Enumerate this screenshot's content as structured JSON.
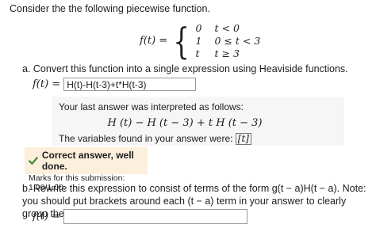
{
  "intro": "Consider the the following piecewise function.",
  "piecewise": {
    "lhs": "f(t) =",
    "cases": [
      {
        "value": "0",
        "condition": "t < 0"
      },
      {
        "value": "1",
        "condition": "0 ≤ t < 3"
      },
      {
        "value": "t",
        "condition": "t ≥ 3"
      }
    ]
  },
  "part_a": {
    "question": "a. Convert this function into a single expression using Heaviside functions.",
    "lhs": "f(t) =",
    "answer_value": "H(t)-H(t-3)+t*H(t-3)",
    "interpreted_label": "Your last answer was interpreted as follows:",
    "interpreted_math": "H (t) − H (t − 3) + t H (t − 3)",
    "variables_label": "The variables found in your answer were:",
    "variables": "[t]",
    "feedback_title": "Correct answer, well done.",
    "feedback_marks": "Marks for this submission: 1.00/1.00.",
    "feedback_color": "#fcefdc",
    "check_color": "#3a8a2e"
  },
  "part_b": {
    "question": "b. Rewrite this expression to consist of terms of the form g(t − a)H(t − a). Note: you should put brackets around each (t − a) term in your answer to clearly group them together.",
    "lhs": "f(t) =",
    "answer_value": ""
  }
}
